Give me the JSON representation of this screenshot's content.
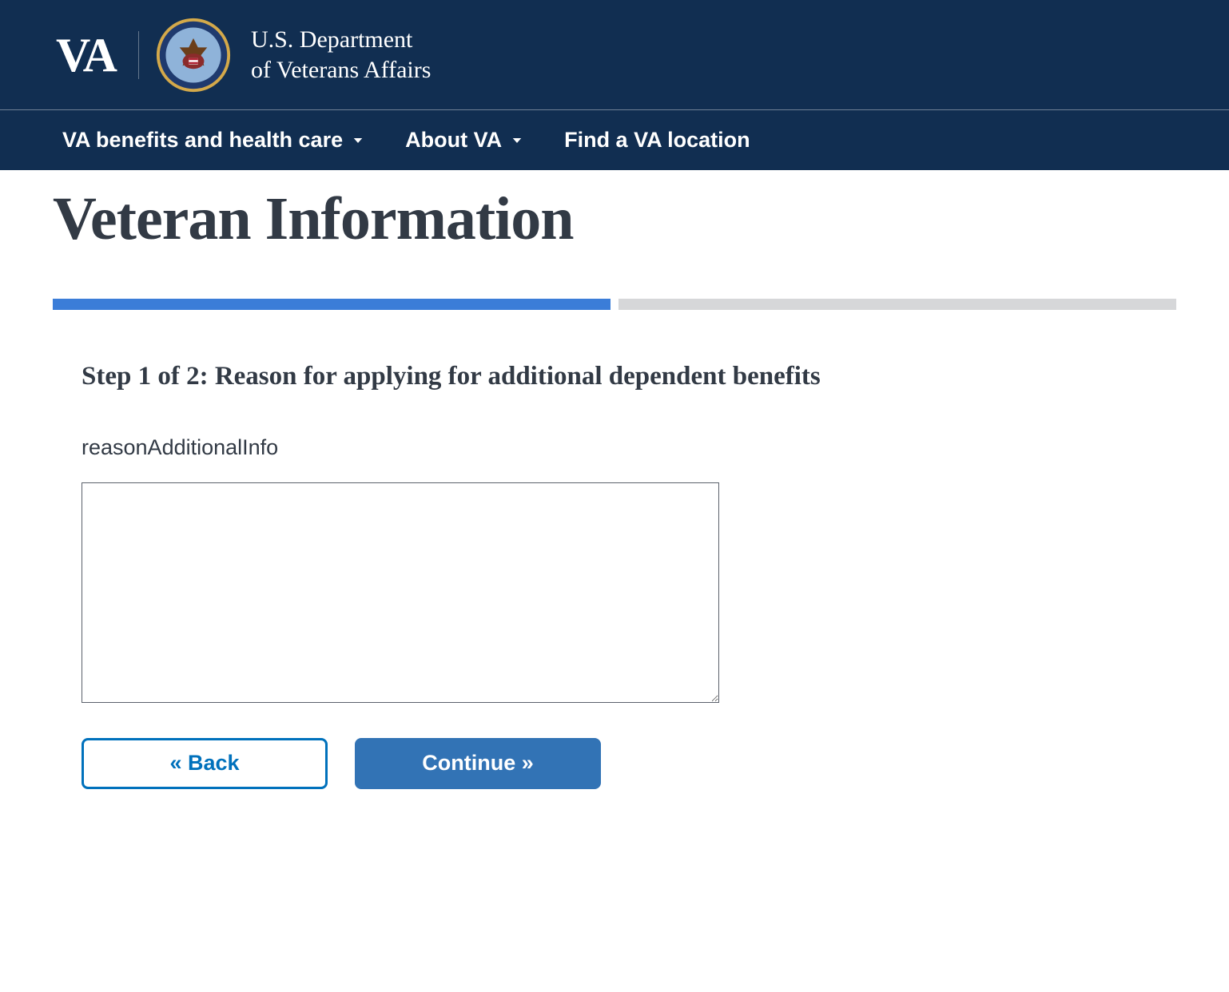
{
  "header": {
    "logo_text": "VA",
    "dept_line1": "U.S. Department",
    "dept_line2": "of Veterans Affairs"
  },
  "nav": {
    "items": [
      {
        "label": "VA benefits and health care",
        "has_dropdown": true
      },
      {
        "label": "About VA",
        "has_dropdown": true
      },
      {
        "label": "Find a VA location",
        "has_dropdown": false
      }
    ]
  },
  "page": {
    "title": "Veteran Information",
    "progress_total": 2,
    "progress_current": 1
  },
  "form": {
    "step_heading": "Step 1 of 2: Reason for applying for additional dependent benefits",
    "field_label": "reasonAdditionalInfo",
    "textarea_value": ""
  },
  "buttons": {
    "back": "« Back",
    "continue": "Continue »"
  }
}
